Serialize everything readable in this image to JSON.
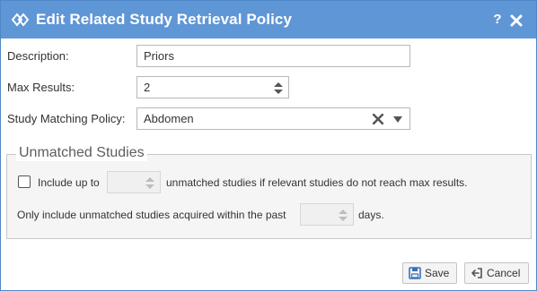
{
  "dialog": {
    "title": "Edit Related Study Retrieval Policy",
    "help_label": "?",
    "title_icon": "diamond-link-icon",
    "close_icon": "close-icon"
  },
  "form": {
    "description": {
      "label": "Description:",
      "value": "Priors"
    },
    "max_results": {
      "label": "Max Results:",
      "value": "2"
    },
    "matching_policy": {
      "label": "Study Matching Policy:",
      "value": "Abdomen"
    }
  },
  "unmatched": {
    "legend": "Unmatched Studies",
    "include_checked": false,
    "include_prefix": "Include up to",
    "include_suffix": "unmatched studies if relevant studies do not reach max results.",
    "include_value": "",
    "within_prefix": "Only include unmatched studies acquired within the past",
    "within_suffix": "days.",
    "within_value": ""
  },
  "footer": {
    "save_label": "Save",
    "cancel_label": "Cancel"
  },
  "colors": {
    "titlebar": "#5f96d6",
    "save_icon": "#3b6fb5"
  }
}
